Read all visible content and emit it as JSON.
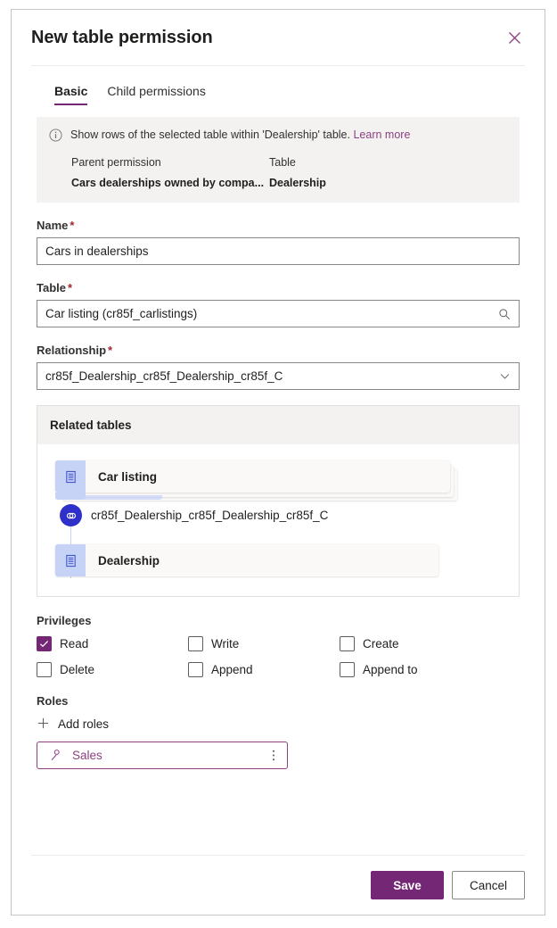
{
  "dialog": {
    "title": "New table permission",
    "close_label": "Close"
  },
  "tabs": [
    {
      "label": "Basic",
      "active": true
    },
    {
      "label": "Child permissions",
      "active": false
    }
  ],
  "info_banner": {
    "icon": "info-icon",
    "message": "Show rows of the selected table within 'Dealership' table.",
    "learn_more": "Learn more",
    "columns": [
      {
        "header": "Parent permission",
        "value": "Cars dealerships owned by compa..."
      },
      {
        "header": "Table",
        "value": "Dealership"
      }
    ]
  },
  "fields": {
    "name": {
      "label": "Name",
      "required": "*",
      "value": "Cars in dealerships",
      "placeholder": ""
    },
    "table": {
      "label": "Table",
      "required": "*",
      "value": "Car listing (cr85f_carlistings)",
      "placeholder": "",
      "icon": "search-icon"
    },
    "relationship": {
      "label": "Relationship",
      "required": "*",
      "value": "cr85f_Dealership_cr85f_Dealership_cr85f_C",
      "icon": "chevron-down-icon"
    }
  },
  "related_tables": {
    "header": "Related tables",
    "source_table": "Car listing",
    "relationship_name": "cr85f_Dealership_cr85f_Dealership_cr85f_C",
    "target_table": "Dealership",
    "table_icon": "table-icon",
    "link_icon": "link-icon"
  },
  "privileges": {
    "label": "Privileges",
    "items": [
      {
        "label": "Read",
        "checked": true
      },
      {
        "label": "Write",
        "checked": false
      },
      {
        "label": "Create",
        "checked": false
      },
      {
        "label": "Delete",
        "checked": false
      },
      {
        "label": "Append",
        "checked": false
      },
      {
        "label": "Append to",
        "checked": false
      }
    ]
  },
  "roles": {
    "label": "Roles",
    "add_label": "Add roles",
    "add_icon": "plus-icon",
    "chips": [
      {
        "name": "Sales",
        "icon": "person-icon",
        "more_icon": "more-vertical-icon"
      }
    ]
  },
  "footer": {
    "save_label": "Save",
    "cancel_label": "Cancel"
  },
  "colors": {
    "accent": "#742774",
    "link": "#8b417f",
    "required": "#a4262c",
    "banner_bg": "#f3f2f1",
    "entity_icon_bg": "#c7d2f7",
    "relationship_badge": "#2f2fc9"
  }
}
